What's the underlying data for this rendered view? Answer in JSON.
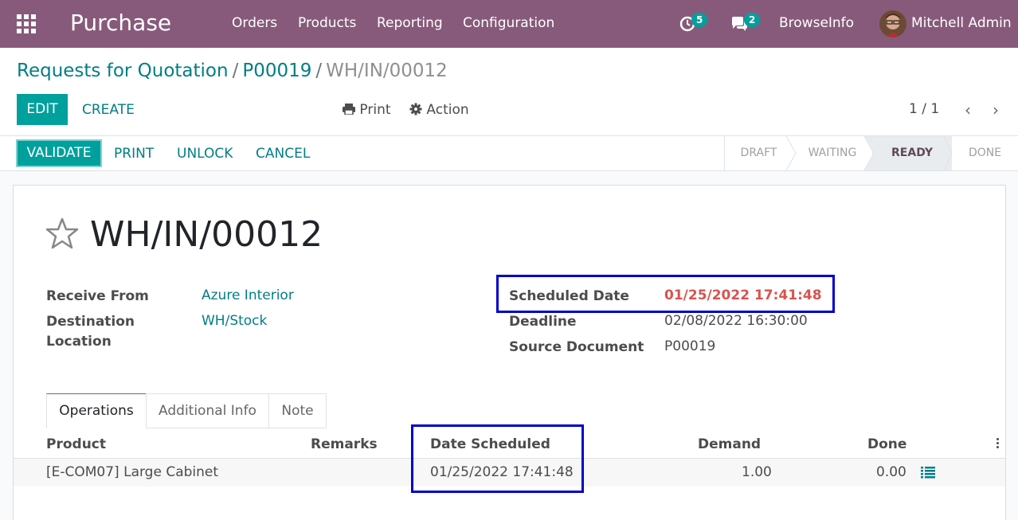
{
  "navbar": {
    "app_title": "Purchase",
    "menu": [
      "Orders",
      "Products",
      "Reporting",
      "Configuration"
    ],
    "activity_count": "5",
    "message_count": "2",
    "company": "BrowseInfo",
    "user": "Mitchell Admin"
  },
  "breadcrumb": {
    "root": "Requests for Quotation",
    "parent": "P00019",
    "current": "WH/IN/00012",
    "separator": "/"
  },
  "control": {
    "edit_label": "EDIT",
    "create_label": "CREATE",
    "print_label": "Print",
    "action_label": "Action",
    "pager_value": "1 / 1",
    "prev_symbol": "‹",
    "next_symbol": "›"
  },
  "statusbar": {
    "buttons": [
      "VALIDATE",
      "PRINT",
      "UNLOCK",
      "CANCEL"
    ],
    "stages": [
      "DRAFT",
      "WAITING",
      "READY",
      "DONE"
    ],
    "active_stage": "READY"
  },
  "record": {
    "name": "WH/IN/00012",
    "fields_left": [
      {
        "label": "Receive From",
        "value": "Azure Interior"
      },
      {
        "label": "Destination Location",
        "value": "WH/Stock"
      }
    ],
    "fields_right": [
      {
        "label": "Scheduled Date",
        "value": "01/25/2022 17:41:48"
      },
      {
        "label": "Deadline",
        "value": "02/08/2022 16:30:00"
      },
      {
        "label": "Source Document",
        "value": "P00019"
      }
    ]
  },
  "tabs": [
    "Operations",
    "Additional Info",
    "Note"
  ],
  "operations": {
    "columns": [
      "Product",
      "Remarks",
      "Date Scheduled",
      "Demand",
      "Done"
    ],
    "rows": [
      {
        "product": "[E-COM07] Large Cabinet",
        "remarks": "",
        "date_scheduled": "01/25/2022 17:41:48",
        "demand": "1.00",
        "done": "0.00"
      }
    ]
  },
  "colors": {
    "brand": "#875a7b",
    "primary": "#00a09d",
    "link": "#017e84",
    "late": "#d9534f",
    "highlight_box": "#0000cc"
  },
  "icons": [
    "apps-grid-icon",
    "clock-icon",
    "chat-icon",
    "print-icon",
    "gear-icon",
    "star-icon",
    "detail-list-icon",
    "kebab-icon"
  ]
}
